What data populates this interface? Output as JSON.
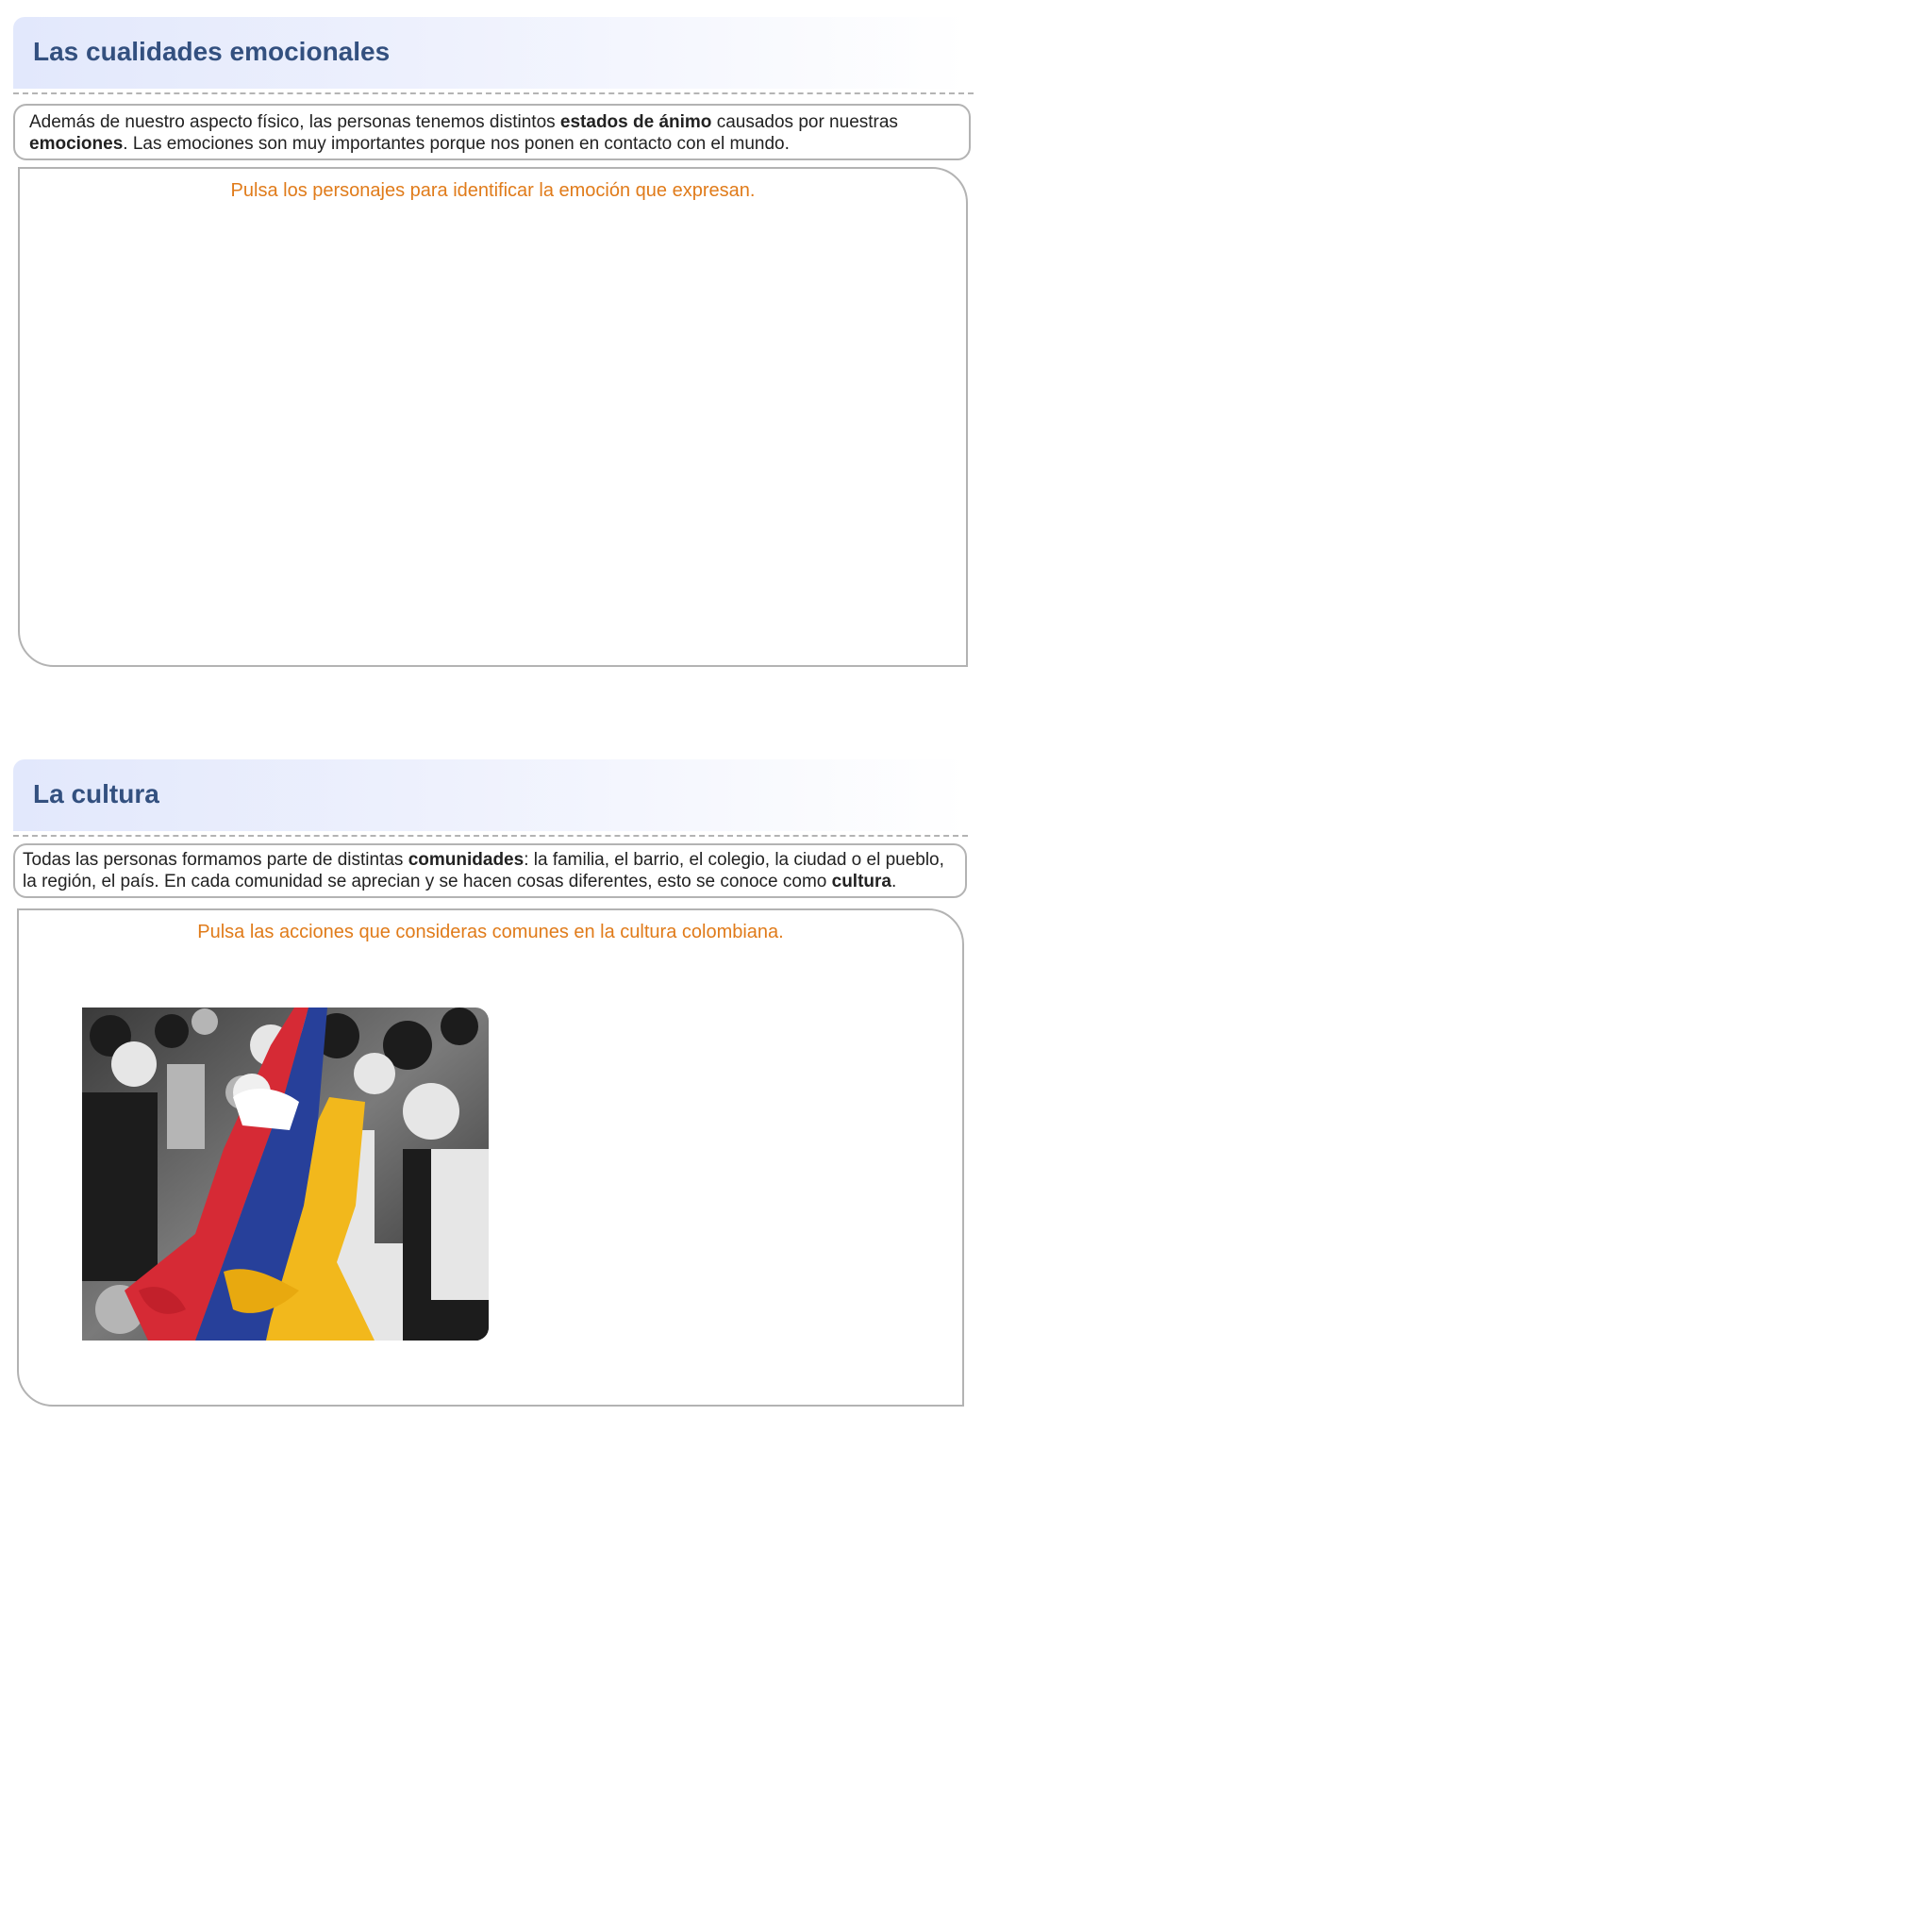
{
  "sections": [
    {
      "title": "Las cualidades emocionales",
      "intro": [
        {
          "text": "Además de nuestro aspecto físico, las personas tenemos distintos ",
          "bold": false
        },
        {
          "text": "estados de ánimo",
          "bold": true
        },
        {
          "text": " causados por nuestras",
          "bold": false
        },
        {
          "br": true
        },
        {
          "text": "emociones",
          "bold": true
        },
        {
          "text": ". Las emociones son muy importantes porque nos ponen en contacto con el mundo.",
          "bold": false
        }
      ],
      "instruction": "Pulsa los personajes para identificar la emoción que expresan."
    },
    {
      "title": "La cultura",
      "intro": [
        {
          "text": "Todas las personas formamos parte de distintas ",
          "bold": false
        },
        {
          "text": "comunidades",
          "bold": true
        },
        {
          "text": ": la familia, el barrio, el colegio, la ciudad o el pueblo,",
          "bold": false
        },
        {
          "br": true
        },
        {
          "text": "la región, el país. En cada comunidad se aprecian y se hacen cosas diferentes, esto se conoce como ",
          "bold": false
        },
        {
          "text": "cultura",
          "bold": true
        },
        {
          "text": ".",
          "bold": false
        }
      ],
      "instruction": "Pulsa las acciones que consideras comunes en la cultura colombiana.",
      "image": {
        "subject": "crowd-carrying-colombian-flag",
        "colors": {
          "yellow": "#f2b81c",
          "blue": "#27409a",
          "red": "#d62a35"
        }
      }
    }
  ]
}
